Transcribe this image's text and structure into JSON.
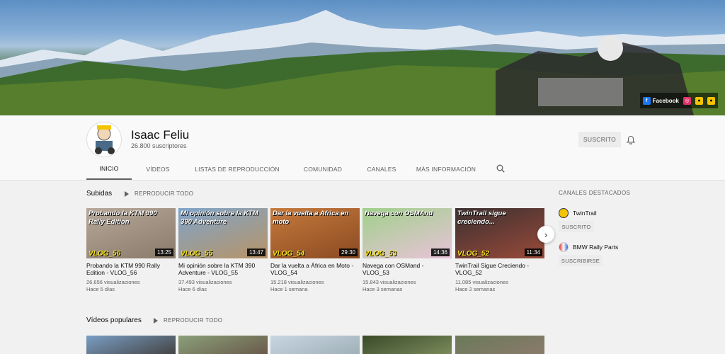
{
  "banner": {
    "social_links": [
      {
        "icon": "facebook-icon",
        "label": "Facebook",
        "color": "#1877f2"
      },
      {
        "icon": "instagram-icon",
        "label": "",
        "color": "#e1306c"
      },
      {
        "icon": "twintrail-icon",
        "label": "",
        "color": "#f5c400"
      },
      {
        "icon": "twintrail-icon-2",
        "label": "",
        "color": "#f5c400"
      }
    ]
  },
  "channel": {
    "name": "Isaac Feliu",
    "subscribers": "26.800 suscriptores",
    "subscribe_label": "SUSCRITO"
  },
  "tabs": [
    {
      "label": "INICIO",
      "active": true
    },
    {
      "label": "VÍDEOS",
      "active": false
    },
    {
      "label": "LISTAS DE REPRODUCCIÓN",
      "active": false
    },
    {
      "label": "COMUNIDAD",
      "active": false
    },
    {
      "label": "CANALES",
      "active": false
    },
    {
      "label": "MÁS INFORMACIÓN",
      "active": false
    }
  ],
  "uploads": {
    "title": "Subidas",
    "play_all": "REPRODUCIR TODO",
    "videos": [
      {
        "thumb_caption": "Probando la KTM 990 Rally Edition",
        "thumb_vlog": "VLOG_56",
        "duration": "13:25",
        "title": "Probando la KTM 990 Rally Edition - VLOG_56",
        "views": "26.656 visualizaciones",
        "age": "Hace 5 días",
        "colors": [
          "#b6a89a",
          "#8a7a6a"
        ]
      },
      {
        "thumb_caption": "Mi opinión sobre la KTM 390 Adventure",
        "thumb_vlog": "VLOG_55",
        "duration": "13:47",
        "title": "Mi opinión sobre la KTM 390 Adventure - VLOG_55",
        "views": "37.493 visualizaciones",
        "age": "Hace 6 días",
        "colors": [
          "#7fa4c9",
          "#b89467"
        ]
      },
      {
        "thumb_caption": "Dar la vuelta a Africa en moto",
        "thumb_vlog": "VLOG_54",
        "duration": "29:30",
        "title": "Dar la vuelta a África en Moto - VLOG_54",
        "views": "15.218 visualizaciones",
        "age": "Hace 1 semana",
        "colors": [
          "#c67a3c",
          "#8a4a22"
        ]
      },
      {
        "thumb_caption": "Navega con OSMAnd",
        "thumb_vlog": "VLOG_53",
        "duration": "14:36",
        "title": "Navega con OSMand - VLOG_53",
        "views": "15.843 visualizaciones",
        "age": "Hace 3 semanas",
        "colors": [
          "#9fd08a",
          "#e9c3d9"
        ]
      },
      {
        "thumb_caption": "TwinTrail sigue creciendo...",
        "thumb_vlog": "VLOG_52",
        "duration": "11:34",
        "title": "TwinTrail Sigue Creciendo - VLOG_52",
        "views": "11.085 visualizaciones",
        "age": "Hace 2 semanas",
        "colors": [
          "#3a3030",
          "#9a4a3a"
        ]
      }
    ]
  },
  "popular": {
    "title": "Vídeos populares",
    "play_all": "REPRODUCIR TODO",
    "thumb_colors": [
      [
        "#7a9ec4",
        "#444"
      ],
      [
        "#8aa07a",
        "#6a5a4a"
      ],
      [
        "#c8d6e2",
        "#a0b0b8"
      ],
      [
        "#3a4a2a",
        "#7a8a5a"
      ],
      [
        "#6a7a5a",
        "#8a7a6a"
      ]
    ]
  },
  "featured": {
    "title": "CANALES DESTACADOS",
    "channels": [
      {
        "name": "TwinTrail",
        "button": "SUSCRITO",
        "color": "#f5c400"
      },
      {
        "name": "BMW Rally Parts",
        "button": "SUSCRIBIRSE",
        "color": "#d33"
      }
    ]
  }
}
